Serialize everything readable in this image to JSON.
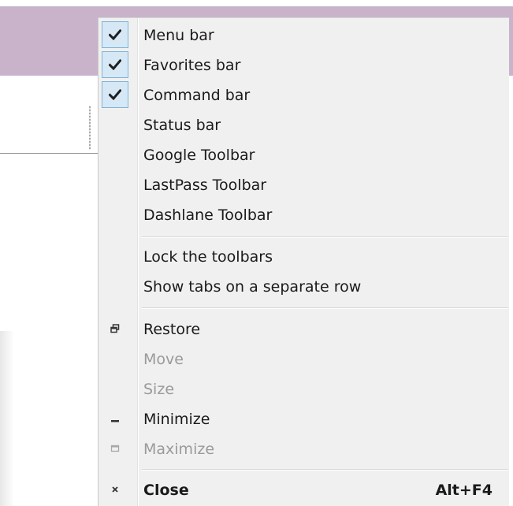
{
  "menu": {
    "toolbar_items": [
      {
        "label": "Menu bar",
        "checked": true
      },
      {
        "label": "Favorites bar",
        "checked": true
      },
      {
        "label": "Command bar",
        "checked": true
      },
      {
        "label": "Status bar",
        "checked": false
      },
      {
        "label": "Google Toolbar",
        "checked": false
      },
      {
        "label": "LastPass Toolbar",
        "checked": false
      },
      {
        "label": "Dashlane Toolbar",
        "checked": false
      }
    ],
    "options": [
      {
        "label": "Lock the toolbars"
      },
      {
        "label": "Show tabs on a separate row"
      }
    ],
    "window_items": [
      {
        "label": "Restore",
        "icon": "restore-icon",
        "enabled": true
      },
      {
        "label": "Move",
        "icon": "",
        "enabled": false
      },
      {
        "label": "Size",
        "icon": "",
        "enabled": false
      },
      {
        "label": "Minimize",
        "icon": "minimize-icon",
        "enabled": true
      },
      {
        "label": "Maximize",
        "icon": "maximize-icon",
        "enabled": false
      }
    ],
    "close": {
      "label": "Close",
      "shortcut": "Alt+F4",
      "icon": "close-icon"
    }
  },
  "colors": {
    "title_bar": "#c9b3cb",
    "menu_background": "#f0f0f0",
    "check_highlight": "#d6e8f5",
    "check_border": "#7fb3d8",
    "disabled_text": "#9a9a9a"
  }
}
